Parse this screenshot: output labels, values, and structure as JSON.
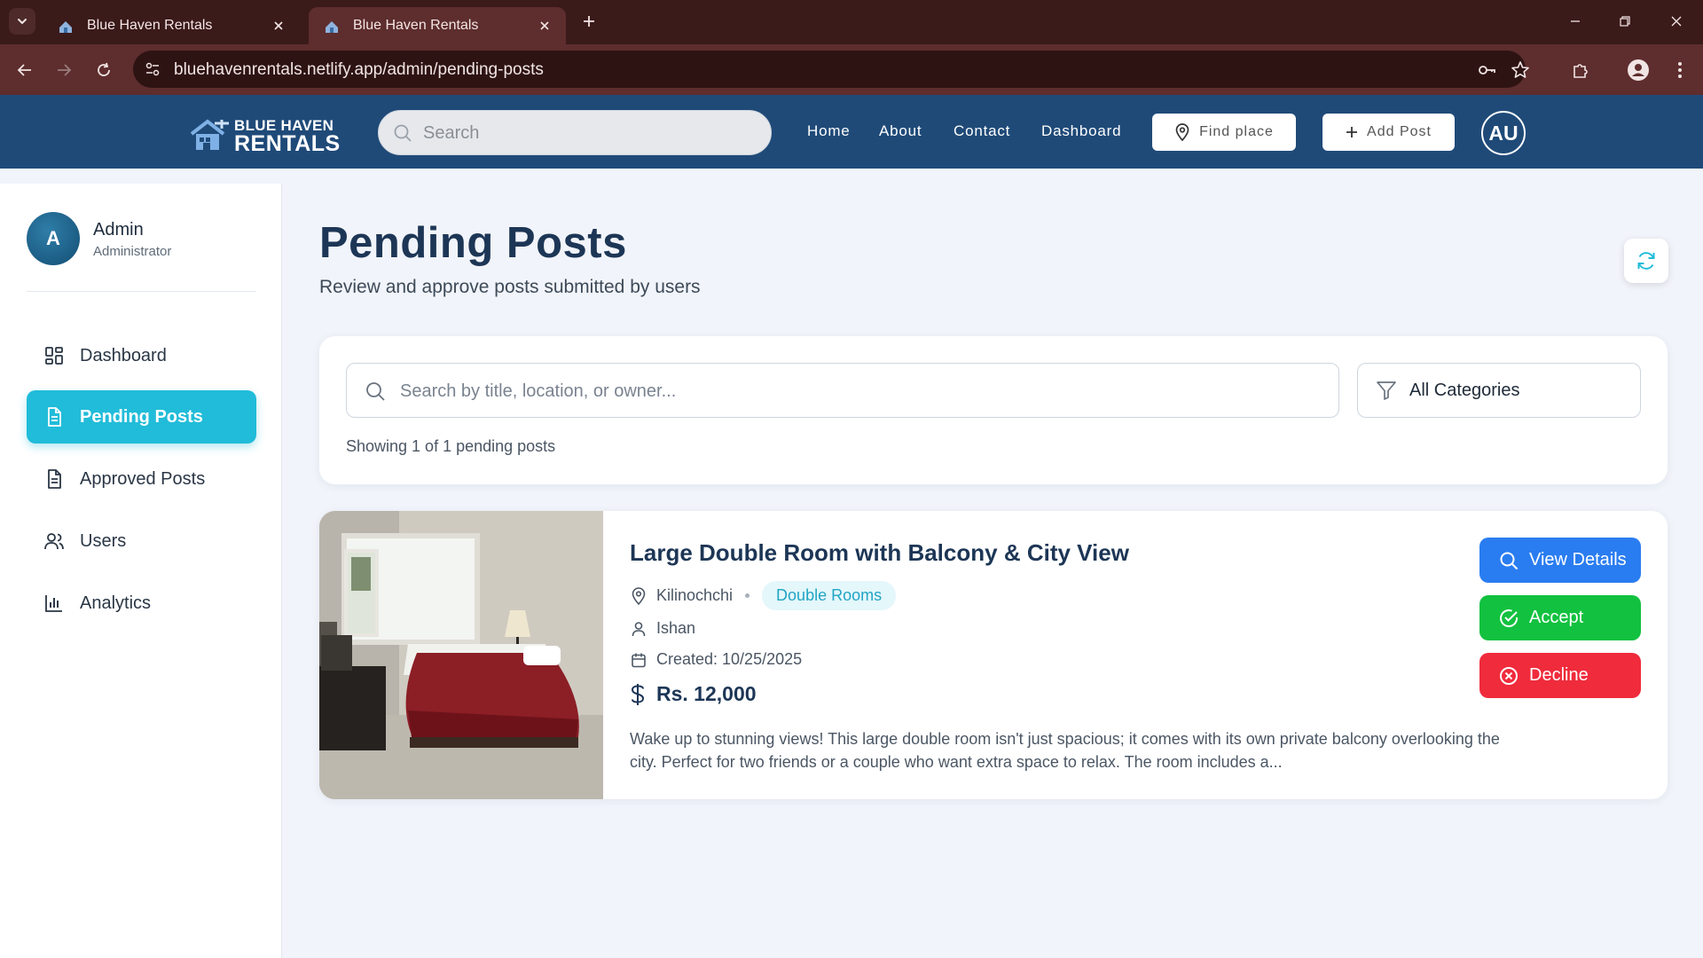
{
  "browser": {
    "tabs": [
      {
        "title": "Blue Haven Rentals"
      },
      {
        "title": "Blue Haven Rentals"
      }
    ],
    "url": "bluehavenrentals.netlify.app/admin/pending-posts"
  },
  "header": {
    "logo": {
      "line1": "BLUE HAVEN",
      "line2": "RENTALS"
    },
    "search_placeholder": "Search",
    "nav": [
      "Home",
      "About",
      "Contact",
      "Dashboard"
    ],
    "find_place_label": "Find place",
    "add_post_label": "Add Post",
    "avatar_initials": "AU"
  },
  "sidebar": {
    "user": {
      "initial": "A",
      "name": "Admin",
      "role": "Administrator"
    },
    "items": [
      {
        "label": "Dashboard",
        "icon": "grid-icon",
        "active": false
      },
      {
        "label": "Pending Posts",
        "icon": "document-icon",
        "active": true
      },
      {
        "label": "Approved Posts",
        "icon": "document-icon",
        "active": false
      },
      {
        "label": "Users",
        "icon": "users-icon",
        "active": false
      },
      {
        "label": "Analytics",
        "icon": "bar-chart-icon",
        "active": false
      }
    ]
  },
  "main": {
    "title": "Pending Posts",
    "subtitle": "Review and approve posts submitted by users",
    "search_placeholder": "Search by title, location, or owner...",
    "category_value": "All Categories",
    "showing_text": "Showing 1 of 1 pending posts",
    "posts": [
      {
        "title": "Large Double Room with Balcony & City View",
        "location": "Kilinochchi",
        "category": "Double Rooms",
        "owner": "Ishan",
        "created": "Created: 10/25/2025",
        "price": "Rs. 12,000",
        "description": "Wake up to stunning views! This large double room isn't just spacious; it comes with its own private balcony overlooking the city. Perfect for two friends or a couple who want extra space to relax. The room includes a...",
        "actions": {
          "view": "View Details",
          "accept": "Accept",
          "decline": "Decline"
        }
      }
    ]
  },
  "colors": {
    "header_bg": "#1f4a78",
    "accent_cyan": "#21bcd9",
    "view_blue": "#2a7df0",
    "accept_green": "#12c13f",
    "decline_red": "#ef2b3c",
    "title_navy": "#1d3656"
  }
}
